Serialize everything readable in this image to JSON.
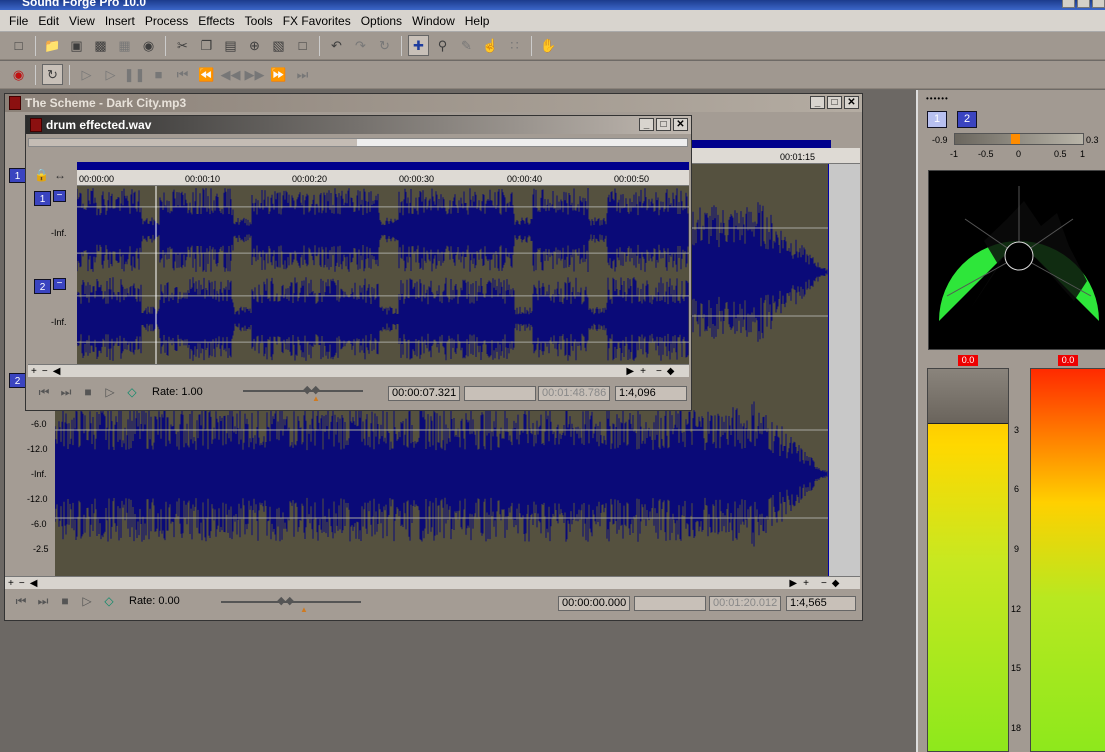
{
  "app": {
    "title": "Sound Forge Pro 10.0"
  },
  "menu": [
    "File",
    "Edit",
    "View",
    "Insert",
    "Process",
    "Effects",
    "Tools",
    "FX Favorites",
    "Options",
    "Window",
    "Help"
  ],
  "toolbar1_icons": [
    "new-icon",
    "open-icon",
    "save-icon",
    "save-as-icon",
    "render-icon",
    "cd-icon",
    "cut-icon",
    "copy-icon",
    "paste-icon",
    "mix-icon",
    "crop-icon",
    "trim-icon",
    "undo-icon",
    "redo-icon",
    "repeat-icon",
    "edit-tool-icon",
    "magnify-tool-icon",
    "pencil-tool-icon",
    "envelope-tool-icon",
    "event-tool-icon",
    "properties-icon"
  ],
  "toolbar2_icons": [
    "record-icon",
    "loop-icon",
    "play-all-icon",
    "play-icon",
    "pause-icon",
    "stop-icon",
    "go-to-start-icon",
    "rewind-icon",
    "previous-icon",
    "next-icon",
    "forward-icon",
    "go-to-end-icon"
  ],
  "scheme_window": {
    "title": "The Scheme - Dark City.mp3",
    "ruler_end": "00:01:15",
    "channel_labels": [
      "1",
      "2"
    ],
    "db_labels": [
      "-6.0",
      "-12.0",
      "-Inf.",
      "-12.0",
      "-6.0",
      "-2.5"
    ],
    "rate": "Rate: 0.00",
    "position": "00:00:00.000",
    "selection": "",
    "length": "00:01:20.012",
    "zoom": "1:4,565"
  },
  "drum_window": {
    "title": "drum effected.wav",
    "ruler_ticks": [
      "00:00:00",
      "00:00:10",
      "00:00:20",
      "00:00:30",
      "00:00:40",
      "00:00:50"
    ],
    "channel_labels": [
      "1",
      "2"
    ],
    "db_labels": [
      "-Inf.",
      "-Inf."
    ],
    "rate": "Rate: 1.00",
    "position": "00:00:07.321",
    "selection": "",
    "length": "00:01:48.786",
    "zoom": "1:4,096"
  },
  "meters": {
    "channel_buttons": [
      "1",
      "2"
    ],
    "balance_scale": [
      "-0.9",
      "-1",
      "-0.5",
      "0",
      "0.5",
      "1",
      "0.3"
    ],
    "peak_left": "0.0",
    "peak_right": "0.0",
    "db_scale": [
      "3",
      "6",
      "9",
      "12",
      "15",
      "18"
    ],
    "colors": {
      "meter_top": "#ff2a00",
      "meter_mid": "#ffb000",
      "meter_low": "#9ee81c",
      "scope": "#2ee63a"
    }
  }
}
